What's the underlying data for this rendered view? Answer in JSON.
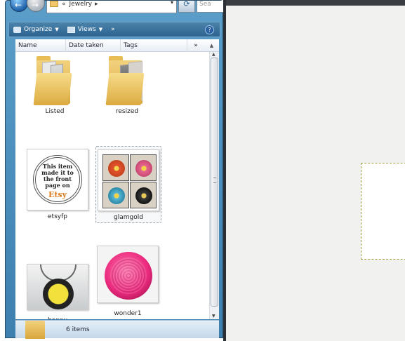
{
  "address": {
    "crumb_sep": "«",
    "crumb": "Jewelry",
    "arrow": "▸",
    "dropdown": "▾",
    "refresh_icon": "⟳",
    "search_placeholder": "Sea"
  },
  "toolbar": {
    "organize_label": "Organize",
    "views_label": "Views",
    "dropdown_arrow": "▼",
    "more": "»",
    "help": "?"
  },
  "columns": {
    "name": "Name",
    "date_taken": "Date taken",
    "tags": "Tags",
    "more": "»",
    "scroll_up": "▲"
  },
  "items": [
    {
      "label": "Listed"
    },
    {
      "label": "resized"
    },
    {
      "label": "etsyfp",
      "badge_text": "This item\nmade it to\nthe front\npage on",
      "badge_brand": "Etsy"
    },
    {
      "label": "glamgold"
    },
    {
      "label": "happy"
    },
    {
      "label": "wonder1"
    }
  ],
  "scrollbar": {
    "up": "▲",
    "down": "▼"
  },
  "status": {
    "count": "6 items"
  },
  "colors": {
    "window_frame": "#3d7fae",
    "folder": "#e8bd55",
    "canvas_bg": "#f1f1ef",
    "marquee": "#a0a040"
  }
}
